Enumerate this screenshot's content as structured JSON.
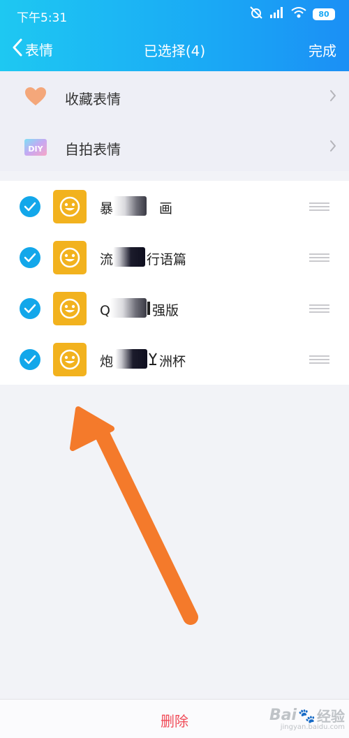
{
  "status_bar": {
    "time": "下午5:31",
    "battery": "80"
  },
  "nav": {
    "back_label": "表情",
    "title": "已选择(4)",
    "done_label": "完成"
  },
  "menu": [
    {
      "label": "收藏表情",
      "icon": "heart-icon"
    },
    {
      "label": "自拍表情",
      "icon": "diy-icon",
      "icon_text": "DIY"
    }
  ],
  "stickers": [
    {
      "visible_start": "暴",
      "visible_end": "画",
      "selected": true
    },
    {
      "visible_start": "流",
      "visible_end": "行语篇",
      "selected": true
    },
    {
      "visible_start": "Q",
      "visible_end": "强版",
      "selected": true
    },
    {
      "visible_start": "炮",
      "visible_end": "洲杯",
      "selected": true
    }
  ],
  "footer": {
    "delete_label": "删除"
  },
  "watermark": {
    "brand": "Bai",
    "brand2": "经验",
    "url": "jingyan.baidu.com"
  },
  "colors": {
    "header_start": "#1ec8f2",
    "header_end": "#1b8ff5",
    "check": "#13a7ea",
    "thumb": "#f2b21e",
    "delete": "#f04a57",
    "arrow": "#f47a2b"
  }
}
